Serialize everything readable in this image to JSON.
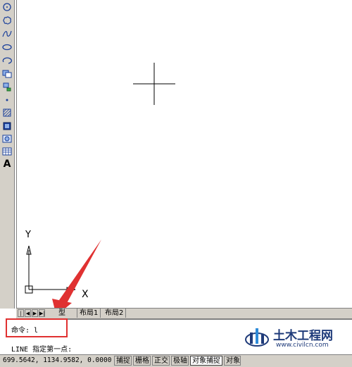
{
  "tabs": {
    "model": "型",
    "layout1": "布局1",
    "layout2": "布局2"
  },
  "command": {
    "line1": "命令: l",
    "line2": "LINE 指定第一点:"
  },
  "ucs": {
    "y_label": "Y",
    "x_label": "X"
  },
  "status": {
    "coords": "699.5642,  1134.9582, 0.0000",
    "buttons": [
      "捕捉",
      "栅格",
      "正交",
      "极轴",
      "对象捕捉",
      "对象"
    ]
  },
  "toolbar": {
    "text_tool": "A",
    "icons": [
      "circle-icon",
      "revcloud-icon",
      "spline-icon",
      "ellipse-icon",
      "ellipse-arc-icon",
      "insert-block-icon",
      "make-block-icon",
      "point-icon",
      "hatch-icon",
      "gradient-icon",
      "region-icon",
      "table-icon",
      "multiline-text-icon"
    ]
  },
  "watermark": {
    "title": "土木工程网",
    "url": "www.civilcn.com"
  },
  "colors": {
    "annotation_red": "#e03131",
    "toolbar_bg": "#d4d0c8",
    "watermark_blue": "#1f3b7a"
  }
}
